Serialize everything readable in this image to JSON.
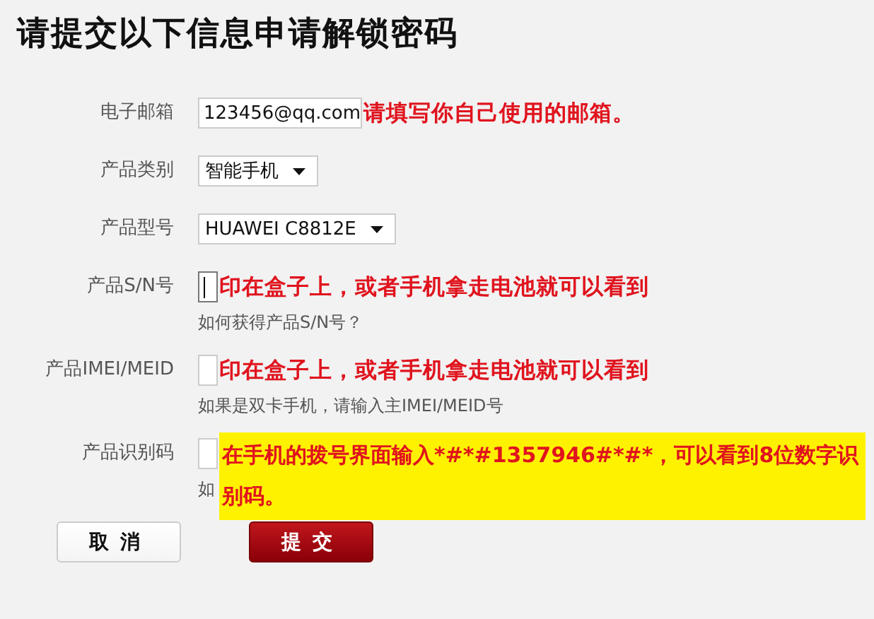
{
  "title": "请提交以下信息申请解锁密码",
  "fields": [
    {
      "kind": "text",
      "label": "电子邮箱",
      "value": "123456@qq.com",
      "focused": false,
      "note": "请填写你自己使用的邮箱。",
      "highlighted": false
    },
    {
      "kind": "select",
      "label": "产品类别",
      "value": "智能手机"
    },
    {
      "kind": "select",
      "label": "产品型号",
      "value": "HUAWEI C8812E"
    },
    {
      "kind": "text",
      "label": "产品S/N号",
      "focused": true,
      "note": "印在盒子上，或者手机拿走电池就可以看到",
      "highlighted": false,
      "hint": "如何获得产品S/N号？"
    },
    {
      "kind": "text",
      "label": "产品IMEI/MEID",
      "focused": false,
      "note": "印在盒子上，或者手机拿走电池就可以看到",
      "highlighted": false,
      "hint": "如果是双卡手机，请输入主IMEI/MEID号"
    },
    {
      "kind": "text",
      "label": "产品识别码",
      "focused": false,
      "note": "在手机的拨号界面输入*#*#1357946#*#*，可以看到8位数字识别码。",
      "highlighted": true,
      "hint": "如"
    }
  ],
  "buttons": [
    {
      "kind": "cancel",
      "label": "取消"
    },
    {
      "kind": "submit",
      "label": "提交"
    }
  ]
}
